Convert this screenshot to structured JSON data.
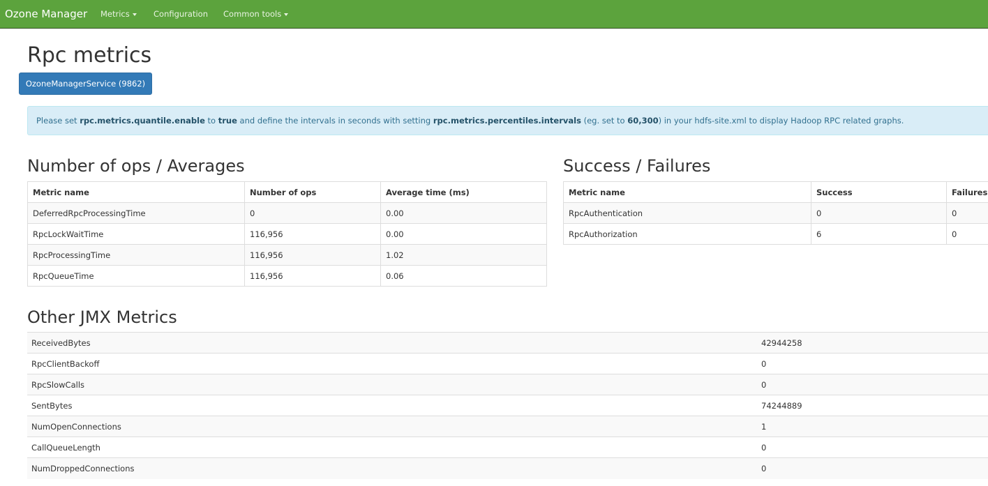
{
  "navbar": {
    "brand": "Ozone Manager",
    "items": [
      {
        "label": "Metrics",
        "dropdown": true
      },
      {
        "label": "Configuration",
        "dropdown": false
      },
      {
        "label": "Common tools",
        "dropdown": true
      }
    ]
  },
  "page_title": "Rpc metrics",
  "service_button": "OzoneManagerService (9862)",
  "alert": {
    "t1": "Please set ",
    "b1": "rpc.metrics.quantile.enable",
    "t2": " to ",
    "b2": "true",
    "t3": " and define the intervals in seconds with setting ",
    "b3": "rpc.metrics.percentiles.intervals",
    "t4": " (eg. set to ",
    "b4": "60,300",
    "t5": ") in your hdfs-site.xml to display Hadoop RPC related graphs."
  },
  "ops_section": {
    "title": "Number of ops / Averages",
    "headers": [
      "Metric name",
      "Number of ops",
      "Average time (ms)"
    ],
    "rows": [
      [
        "DeferredRpcProcessingTime",
        "0",
        "0.00"
      ],
      [
        "RpcLockWaitTime",
        "116,956",
        "0.00"
      ],
      [
        "RpcProcessingTime",
        "116,956",
        "1.02"
      ],
      [
        "RpcQueueTime",
        "116,956",
        "0.06"
      ]
    ]
  },
  "success_section": {
    "title": "Success / Failures",
    "headers": [
      "Metric name",
      "Success",
      "Failures"
    ],
    "rows": [
      [
        "RpcAuthentication",
        "0",
        "0"
      ],
      [
        "RpcAuthorization",
        "6",
        "0"
      ]
    ]
  },
  "jmx_section": {
    "title": "Other JMX Metrics",
    "rows": [
      [
        "ReceivedBytes",
        "42944258"
      ],
      [
        "RpcClientBackoff",
        "0"
      ],
      [
        "RpcSlowCalls",
        "0"
      ],
      [
        "SentBytes",
        "74244889"
      ],
      [
        "NumOpenConnections",
        "1"
      ],
      [
        "CallQueueLength",
        "0"
      ],
      [
        "NumDroppedConnections",
        "0"
      ]
    ]
  }
}
